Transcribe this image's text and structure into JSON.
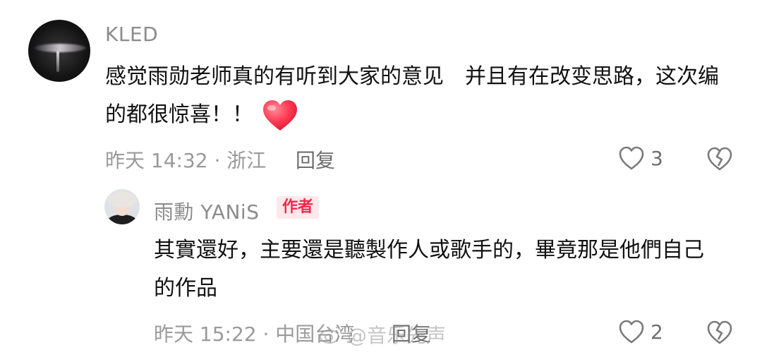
{
  "comment": {
    "username": "KLED",
    "text": "感觉雨勋老师真的有听到大家的意见　并且有在改变思路，这次编的都很惊喜！！",
    "meta": "昨天 14:32 · 浙江",
    "reply_label": "回复",
    "likes": "3",
    "emoji": "red-heart"
  },
  "reply": {
    "username": "雨勳 YANiS",
    "badge": "作者",
    "text": "其實還好，主要還是聽製作人或歌手的，畢竟那是他們自己的作品",
    "meta": "昨天 15:22 · 中国台湾",
    "reply_label": "回复",
    "likes": "2"
  },
  "watermark": {
    "text": "@音乐先声",
    "icon": "weibo-icon"
  },
  "colors": {
    "badge_text": "#f5284a",
    "badge_bg": "#fde8ec",
    "heart": "#ff3b55",
    "meta": "#9a9a9a"
  }
}
